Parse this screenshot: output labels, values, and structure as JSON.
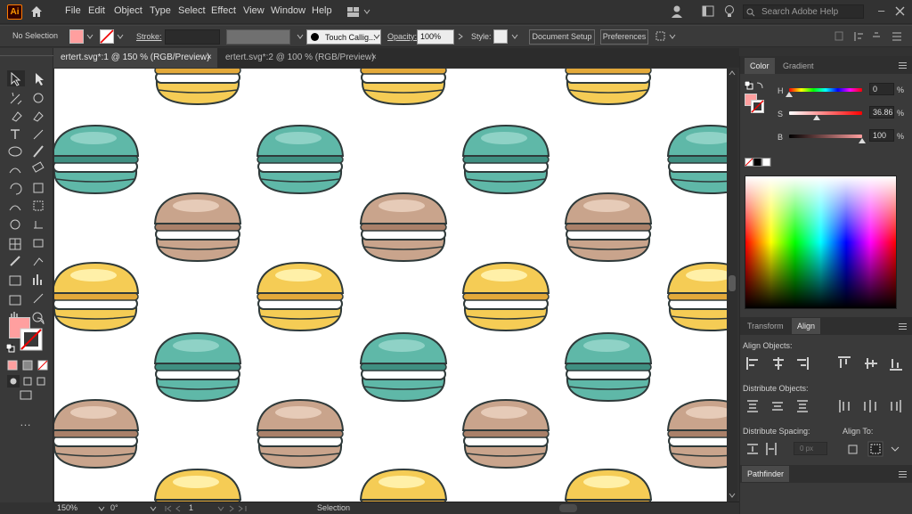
{
  "menubar": {
    "logo": "Ai",
    "menus": [
      "File",
      "Edit",
      "Object",
      "Type",
      "Select",
      "Effect",
      "View",
      "Window",
      "Help"
    ],
    "search_placeholder": "Search Adobe Help"
  },
  "controlbar": {
    "selection_label": "No Selection",
    "stroke_label": "Stroke:",
    "brush_label": "Touch Callig...",
    "opacity_label": "Opacity:",
    "opacity_value": "100%",
    "style_label": "Style:",
    "doc_setup": "Document Setup",
    "preferences": "Preferences"
  },
  "tabs": [
    {
      "label": "ertert.svg*:1 @ 150 % (RGB/Preview)",
      "close": "×"
    },
    {
      "label": "ertert.svg*:2 @ 100 % (RGB/Preview)",
      "close": "×"
    }
  ],
  "status": {
    "zoom": "150%",
    "rotation": "0°",
    "page": "1",
    "tool": "Selection"
  },
  "color_panel": {
    "tabs": [
      "Color",
      "Gradient"
    ],
    "h_label": "H",
    "h_value": "0",
    "h_unit": "%",
    "s_label": "S",
    "s_value": "36.86",
    "s_unit": "%",
    "b_label": "B",
    "b_value": "100",
    "b_unit": "%"
  },
  "align_panel": {
    "tabs": [
      "Transform",
      "Align"
    ],
    "align_objects": "Align Objects:",
    "distribute_objects": "Distribute Objects:",
    "distribute_spacing": "Distribute Spacing:",
    "align_to": "Align To:",
    "spacing_value": "0 px"
  },
  "pathfinder": {
    "title": "Pathfinder"
  },
  "colors": {
    "fill": "#ff9f9f",
    "teal": "#5fb8a8",
    "yellow": "#f5cc55",
    "tan": "#c9a48c",
    "ui_bg": "#323232"
  }
}
